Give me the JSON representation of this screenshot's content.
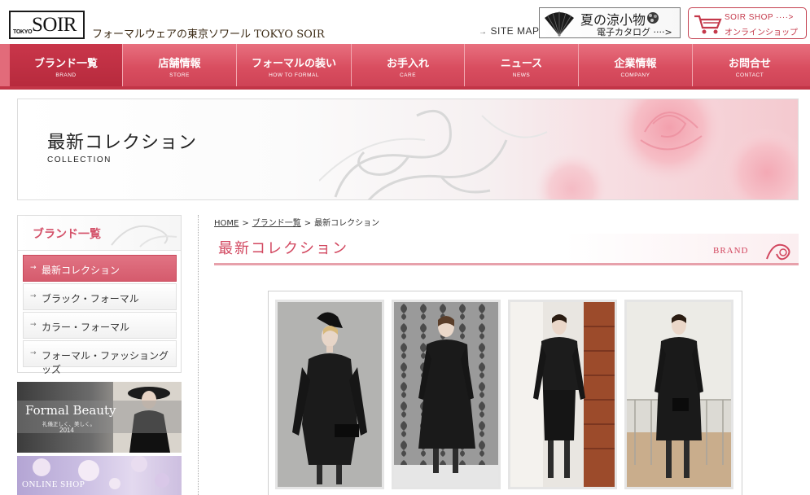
{
  "header": {
    "logo_tokyo": "TOKYO",
    "logo_soir": "SOIR",
    "tagline": "フォーマルウェアの東京ソワール TOKYO SOIR",
    "sitemap": "SITE MAP",
    "catalog_banner": {
      "title": "夏の涼小物",
      "subtitle": "電子カタログ ····>"
    },
    "shop_banner": {
      "title": "SOIR SHOP ····>",
      "subtitle": "オンラインショップ"
    }
  },
  "nav": [
    {
      "jp": "ブランド一覧",
      "en": "BRAND",
      "active": true
    },
    {
      "jp": "店舗情報",
      "en": "STORE",
      "active": false
    },
    {
      "jp": "フォーマルの装い",
      "en": "HOW TO FORMAL",
      "active": false
    },
    {
      "jp": "お手入れ",
      "en": "CARE",
      "active": false
    },
    {
      "jp": "ニュース",
      "en": "NEWS",
      "active": false
    },
    {
      "jp": "企業情報",
      "en": "COMPANY",
      "active": false
    },
    {
      "jp": "お問合せ",
      "en": "CONTACT",
      "active": false
    }
  ],
  "hero": {
    "title": "最新コレクション",
    "subtitle": "COLLECTION"
  },
  "sidebar": {
    "title": "ブランド一覧",
    "items": [
      {
        "label": "最新コレクション",
        "active": true
      },
      {
        "label": "ブラック・フォーマル",
        "active": false
      },
      {
        "label": "カラー・フォーマル",
        "active": false
      },
      {
        "label": "フォーマル・ファッショングッズ",
        "active": false
      }
    ],
    "banner_formal_beauty": {
      "title": "Formal Beauty",
      "subtitle": "礼儀正しく、美しく。",
      "year": "2014"
    },
    "banner_online_shop": {
      "title": "ONLINE SHOP"
    }
  },
  "breadcrumb": {
    "home": "HOME",
    "brand": "ブランド一覧",
    "current": "最新コレクション",
    "separator": ">"
  },
  "section": {
    "title": "最新コレクション",
    "tag": "BRAND"
  },
  "colors": {
    "accent": "#d2475f",
    "nav": "#d94e60",
    "active_nav": "#b72a3d"
  }
}
